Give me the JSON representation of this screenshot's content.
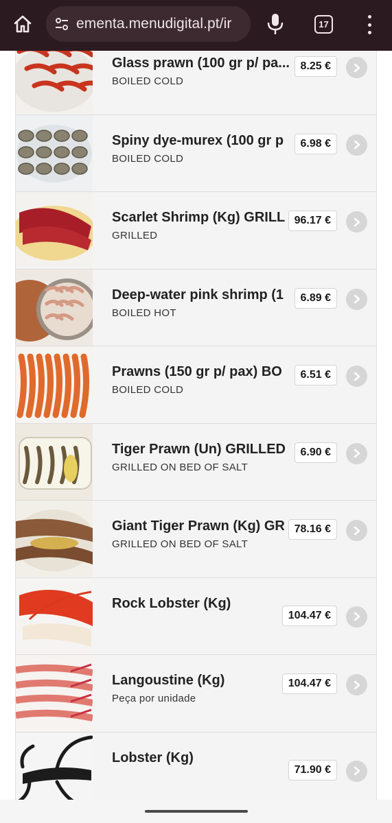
{
  "browser": {
    "url": "ementa.menudigital.pt/ir",
    "tab_count": "17",
    "icons": [
      "home-icon",
      "site-settings-icon",
      "mic-icon",
      "tabs-icon",
      "more-menu-icon"
    ]
  },
  "menu": {
    "items": [
      {
        "name": "Glass prawn (100 gr p/ pa...",
        "sub": "BOILED COLD",
        "price": "8.25 €",
        "thumb": "red-prawns"
      },
      {
        "name": "Spiny dye-murex (100 gr p",
        "sub": "BOILED COLD",
        "price": "6.98 €",
        "thumb": "murex"
      },
      {
        "name": "Scarlet Shrimp (Kg) GRILL",
        "sub": "GRILLED",
        "price": "96.17 €",
        "thumb": "scarlet-shrimp"
      },
      {
        "name": "Deep-water pink shrimp (1",
        "sub": "BOILED HOT",
        "price": "6.89 €",
        "thumb": "pink-shrimp"
      },
      {
        "name": "Prawns (150 gr p/ pax) BO",
        "sub": "BOILED COLD",
        "price": "6.51 €",
        "thumb": "prawns"
      },
      {
        "name": "Tiger Prawn (Un) GRILLED",
        "sub": "GRILLED ON BED OF SALT",
        "price": "6.90 €",
        "thumb": "tiger-prawn"
      },
      {
        "name": "Giant Tiger Prawn (Kg) GR",
        "sub": "GRILLED ON BED OF SALT",
        "price": "78.16 €",
        "thumb": "giant-tiger"
      },
      {
        "name": "Rock Lobster (Kg)",
        "sub": "",
        "price": "104.47 €",
        "thumb": "rock-lobster"
      },
      {
        "name": "Langoustine (Kg)",
        "sub": "Peça por unidade",
        "price": "104.47 €",
        "thumb": "langoustine"
      },
      {
        "name": "Lobster (Kg)",
        "sub": "",
        "price": "71.90 €",
        "thumb": "lobster"
      }
    ]
  },
  "colors": {
    "browser_bar": "#2b1a1f",
    "row_bg": "#f4f4f4",
    "chevron_bg": "#d6d6d6"
  }
}
